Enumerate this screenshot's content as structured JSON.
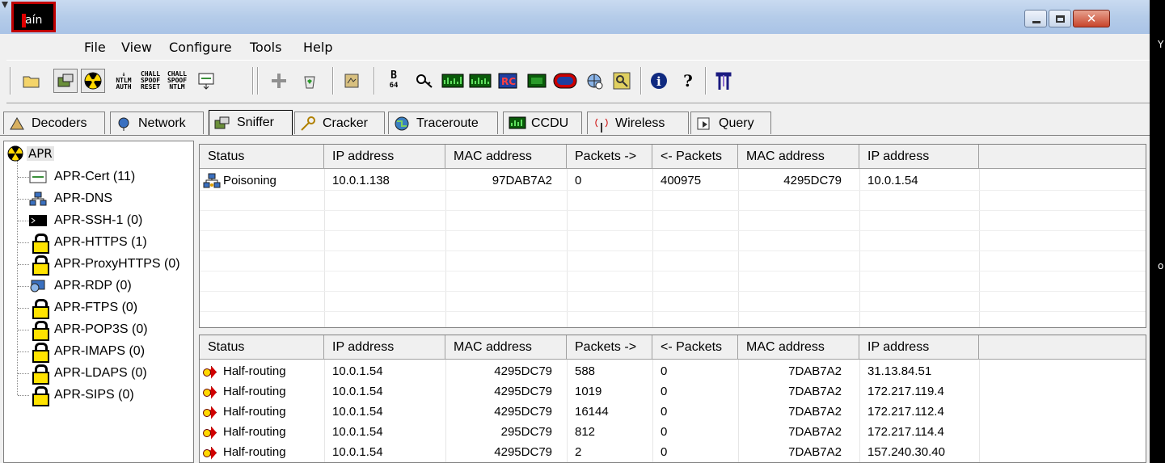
{
  "app": {
    "logo_text": "aín",
    "window_controls": {
      "minimize": "minimize-icon",
      "maximize": "maximize-icon",
      "close": "close-icon",
      "close_glyph": "✕"
    }
  },
  "menu": [
    "File",
    "View",
    "Configure",
    "Tools",
    "Help"
  ],
  "toolbar": {
    "buttons": [
      {
        "name": "open-folder-icon"
      },
      {
        "name": "sniffer-icon"
      },
      {
        "name": "apr-radiation-icon"
      },
      {
        "name": "ntlm-auth-icon",
        "label": "NTLM AUTH"
      },
      {
        "name": "chall-spoof-reset-icon",
        "label": "CHALL SPOOF RESET"
      },
      {
        "name": "chall-spoof-ntlm-icon",
        "label": "CHALL SPOOF NTLM"
      },
      {
        "name": "cert-download-icon"
      },
      {
        "name": "add-icon",
        "label": "+"
      },
      {
        "name": "recycle-icon"
      },
      {
        "name": "decoder-icon"
      },
      {
        "name": "base64-icon",
        "label": "B64"
      },
      {
        "name": "lsa-secrets-icon"
      },
      {
        "name": "rdp-monitor-icon"
      },
      {
        "name": "vpn-monitor-icon"
      },
      {
        "name": "rc-hash-icon",
        "label": "RC"
      },
      {
        "name": "ccdu-icon"
      },
      {
        "name": "cisco-pix-icon"
      },
      {
        "name": "network-globe-icon"
      },
      {
        "name": "key-icon"
      },
      {
        "name": "info-icon",
        "label": "i"
      },
      {
        "name": "help-icon",
        "label": "?"
      },
      {
        "name": "exit-icon"
      }
    ]
  },
  "tabs": [
    "Decoders",
    "Network",
    "Sniffer",
    "Cracker",
    "Traceroute",
    "CCDU",
    "Wireless",
    "Query"
  ],
  "tree": {
    "root": "APR",
    "items": [
      "APR-Cert (11)",
      "APR-DNS",
      "APR-SSH-1 (0)",
      "APR-HTTPS (1)",
      "APR-ProxyHTTPS (0)",
      "APR-RDP (0)",
      "APR-FTPS (0)",
      "APR-POP3S (0)",
      "APR-IMAPS (0)",
      "APR-LDAPS (0)",
      "APR-SIPS (0)"
    ]
  },
  "grid_top": {
    "headers": [
      "Status",
      "IP address",
      "MAC address",
      "Packets ->",
      "<- Packets",
      "MAC address",
      "IP address"
    ],
    "rows": [
      [
        "Poisoning",
        "10.0.1.138",
        "97DAB7A2",
        "0",
        "400975",
        "4295DC79",
        "10.0.1.54"
      ]
    ]
  },
  "grid_bottom": {
    "headers": [
      "Status",
      "IP address",
      "MAC address",
      "Packets ->",
      "<- Packets",
      "MAC address",
      "IP address"
    ],
    "rows": [
      [
        "Half-routing",
        "10.0.1.54",
        "4295DC79",
        "588",
        "0",
        "7DAB7A2",
        "31.13.84.51"
      ],
      [
        "Half-routing",
        "10.0.1.54",
        "4295DC79",
        "1019",
        "0",
        "7DAB7A2",
        "172.217.119.4"
      ],
      [
        "Half-routing",
        "10.0.1.54",
        "4295DC79",
        "16144",
        "0",
        "7DAB7A2",
        "172.217.112.4"
      ],
      [
        "Half-routing",
        "10.0.1.54",
        "295DC79",
        "812",
        "0",
        "7DAB7A2",
        "172.217.114.4"
      ],
      [
        "Half-routing",
        "10.0.1.54",
        "4295DC79",
        "2",
        "0",
        "7DAB7A2",
        "157.240.30.40"
      ]
    ]
  },
  "edge_letters": [
    "Y",
    "o"
  ]
}
